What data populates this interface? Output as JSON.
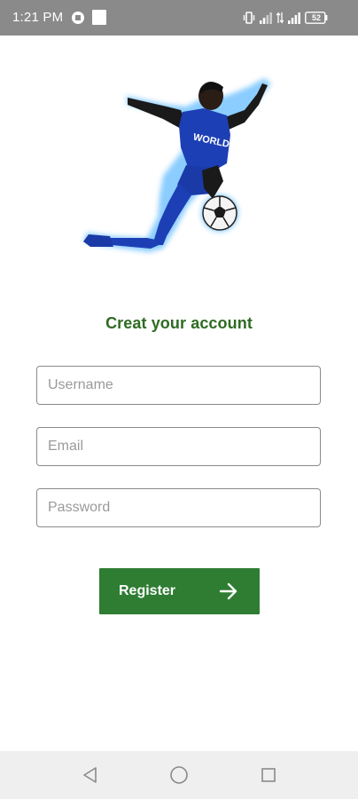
{
  "status_bar": {
    "time": "1:21 PM",
    "battery": "52"
  },
  "form": {
    "title": "Creat your account",
    "username_placeholder": "Username",
    "email_placeholder": "Email",
    "password_placeholder": "Password",
    "register_label": "Register"
  },
  "icons": {
    "hero": "soccer-player-image",
    "register": "arrow-right-icon",
    "nav": [
      "back-icon",
      "home-icon",
      "recents-icon"
    ]
  },
  "colors": {
    "status_bar": "#8a8a8a",
    "title": "#2e6b22",
    "button": "#2e7d32",
    "nav_bar": "#efefef"
  }
}
